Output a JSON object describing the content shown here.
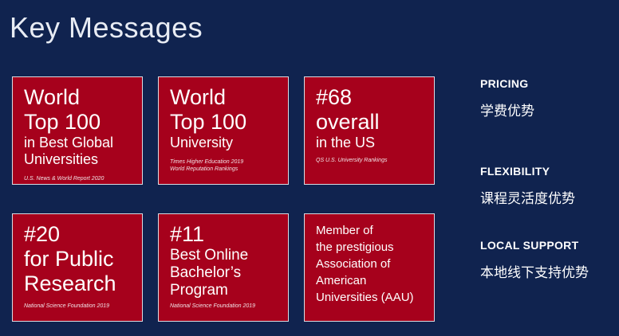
{
  "title": "Key Messages",
  "cards": [
    {
      "lines_big": [
        "World",
        "Top 100"
      ],
      "lines_mid": [
        "in Best Global",
        "Universities"
      ],
      "source": "U.S. News & World Report 2020"
    },
    {
      "lines_big": [
        "World",
        "Top 100"
      ],
      "lines_mid": [
        "University"
      ],
      "source": [
        "Times Higher Education 2019",
        "World Reputation Rankings"
      ]
    },
    {
      "lines_big": [
        "#68",
        "overall"
      ],
      "lines_mid": [
        "in the US"
      ],
      "source": "QS U.S. University Rankings"
    },
    {
      "lines_big": [
        "#20",
        "for Public",
        "Research"
      ],
      "source": "National Science Foundation 2019"
    },
    {
      "lines_big": [
        "#11"
      ],
      "lines_mid": [
        "Best Online",
        "Bachelor’s",
        "Program"
      ],
      "source": "National Science Foundation 2019"
    },
    {
      "lines_small": [
        "Member of",
        "the prestigious",
        "Association of",
        "American",
        "Universities (AAU)"
      ]
    }
  ],
  "side": [
    {
      "heading": "PRICING",
      "chinese": "学费优势"
    },
    {
      "heading": "FLEXIBILITY",
      "chinese": "课程灵活度优势"
    },
    {
      "heading": "LOCAL SUPPORT",
      "chinese": "本地线下支持优势"
    }
  ],
  "colors": {
    "background": "#10234f",
    "card": "#a6011c",
    "border": "#d9dce3"
  }
}
